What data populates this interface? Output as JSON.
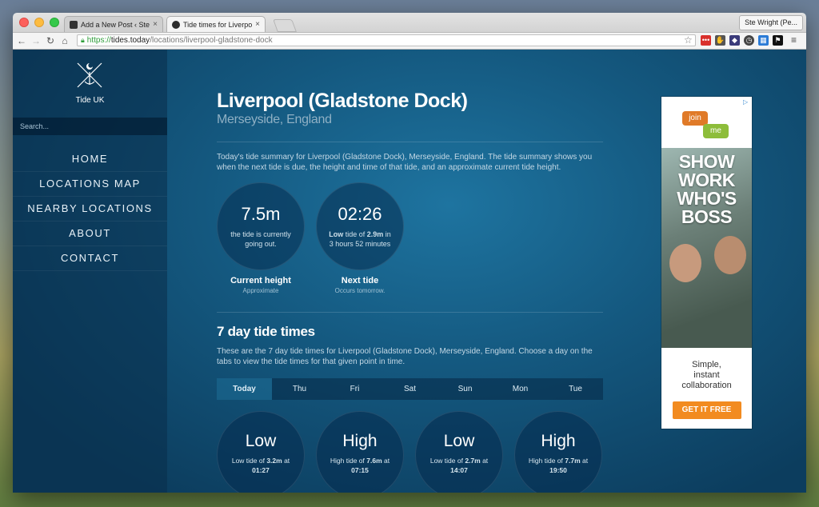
{
  "browser": {
    "tabs": [
      {
        "title": "Add a New Post ‹ Ste Wrigh",
        "active": false
      },
      {
        "title": "Tide times for Liverpool (G",
        "active": true
      }
    ],
    "profile": "Ste Wright (Pe...",
    "url": {
      "scheme": "https://",
      "host": "tides.today",
      "path": "/locations/liverpool-gladstone-dock"
    }
  },
  "sidebar": {
    "brand": "Tide UK",
    "search_placeholder": "Search...",
    "nav": [
      "HOME",
      "LOCATIONS MAP",
      "NEARBY LOCATIONS",
      "ABOUT",
      "CONTACT"
    ]
  },
  "main": {
    "title": "Liverpool (Gladstone Dock)",
    "subtitle": "Merseyside, England",
    "summary": "Today's tide summary for Liverpool (Gladstone Dock), Merseyside, England. The tide summary shows you when the next tide is due, the height and time of that tide, and an approximate current tide height.",
    "current": {
      "value": "7.5m",
      "desc": "the tide is currently going out.",
      "label": "Current height",
      "sub": "Approximate"
    },
    "next": {
      "value": "02:26",
      "desc_prefix": "Low",
      "desc_mid": " tide of ",
      "desc_height": "2.9m",
      "desc_suffix": " in",
      "desc_line2": "3 hours 52 minutes",
      "label": "Next tide",
      "sub": "Occurs tomorrow."
    },
    "week_title": "7 day tide times",
    "week_desc": "These are the 7 day tide times for Liverpool (Gladstone Dock), Merseyside, England. Choose a day on the tabs to view the tide times for that given point in time.",
    "day_tabs": [
      "Today",
      "Thu",
      "Fri",
      "Sat",
      "Sun",
      "Mon",
      "Tue"
    ],
    "tides": [
      {
        "level": "Low",
        "kind": "Low",
        "height": "3.2m",
        "time": "01:27"
      },
      {
        "level": "High",
        "kind": "High",
        "height": "7.6m",
        "time": "07:15"
      },
      {
        "level": "Low",
        "kind": "Low",
        "height": "2.7m",
        "time": "14:07"
      },
      {
        "level": "High",
        "kind": "High",
        "height": "7.7m",
        "time": "19:50"
      }
    ]
  },
  "ad": {
    "join": "join",
    "me": "me",
    "headline": [
      "SHOW",
      "WORK",
      "WHO'S",
      "BOSS"
    ],
    "copy": [
      "Simple,",
      "instant",
      "collaboration"
    ],
    "cta": "GET IT FREE"
  }
}
